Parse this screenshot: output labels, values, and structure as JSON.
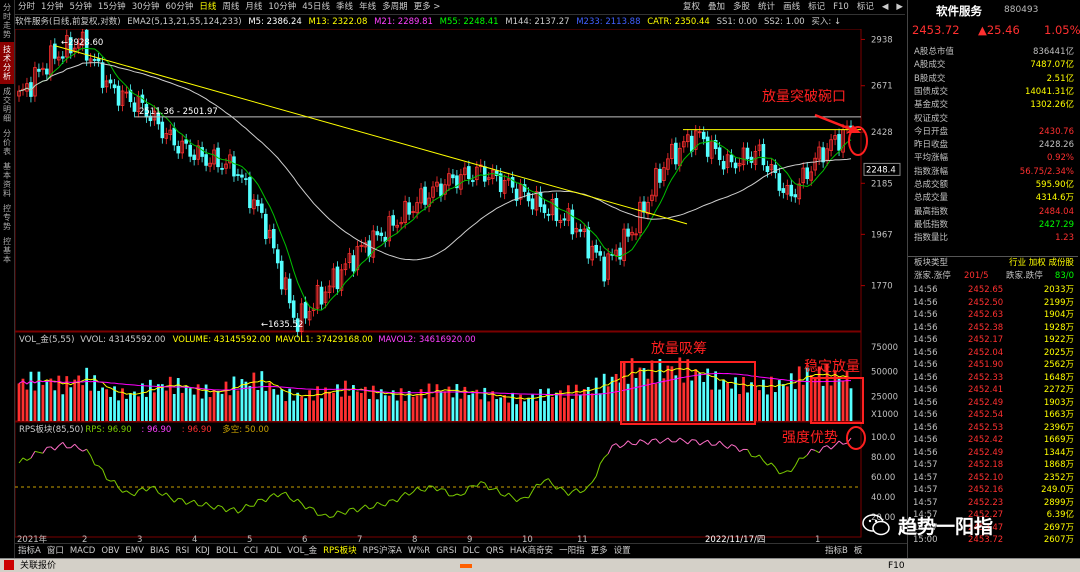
{
  "side_tabs": [
    "分时走势",
    "技术分析",
    "成交明细",
    "分价表",
    "基本资料",
    "控专势",
    "控基本"
  ],
  "active_side_tab": 1,
  "periods": [
    "分时",
    "1分钟",
    "5分钟",
    "15分钟",
    "30分钟",
    "60分钟",
    "日线",
    "周线",
    "月线",
    "10分钟",
    "45日线",
    "季线",
    "年线",
    "多周期",
    "更多 >"
  ],
  "active_period": "日线",
  "toolbar": [
    "复权",
    "叠加",
    "多股",
    "统计",
    "画线",
    "标记",
    "F10",
    "标记",
    "◀",
    "▶"
  ],
  "info": {
    "name": "软件服务(日线,前复权,对数)",
    "ema": "EMA2(5,13,21,55,124,233)",
    "m5": "M5: 2386.24",
    "m13": "M13: 2322.08",
    "m21": "M21: 2289.81",
    "m55": "M55: 2248.41",
    "m144": "M144: 2137.27",
    "m233": "M233: 2113.88",
    "catr": "CATR: 2350.44",
    "ss1": "SS1: 0.00",
    "ss2": "SS2: 1.00",
    "buy": "买入: ↓"
  },
  "price_axis": [
    "2938",
    "2671",
    "2428",
    "2185",
    "1967",
    "1770"
  ],
  "price_tag": "2248.4",
  "price_labels": {
    "high": "2928.60",
    "low": "1635.52",
    "line": "2511.36 - 2501.97"
  },
  "vol_info": {
    "name": "VOL_金(5,55)",
    "vvol": "VVOL: 43145592.00",
    "volume": "VOLUME: 43145592.00",
    "mavol1": "MAVOL1: 37429168.00",
    "mavol2": "MAVOL2: 34616920.00"
  },
  "vol_axis": [
    "75000",
    "50000",
    "25000",
    "X1000"
  ],
  "rps_info": {
    "name": "RPS板块(85,50)",
    "rps": "RPS: 96.90",
    "v2": ": 96.90",
    "v3": ": 96.90",
    "line": "多空: 50.00"
  },
  "rps_axis": [
    "100.0",
    "80.00",
    "60.00",
    "40.00",
    "20.00"
  ],
  "date_axis": [
    "2021年",
    "2",
    "3",
    "4",
    "5",
    "6",
    "7",
    "8",
    "9",
    "10",
    "11",
    "2022/11/17/四",
    "1"
  ],
  "annotations": {
    "breakout": "放量突破碗口",
    "absorb": "放量吸筹",
    "steady": "稳定放量",
    "strength": "强度优势"
  },
  "bottom_indicators": [
    "指标A",
    "窗口",
    "MACD",
    "OBV",
    "EMV",
    "BIAS",
    "RSI",
    "KDJ",
    "BOLL",
    "CCI",
    "ADL",
    "VOL_金",
    "RPS板块",
    "RPS沪深A",
    "W%R",
    "GRSI",
    "DLC",
    "QRS",
    "HAK商奇安",
    "一阳指",
    "更多",
    "设置"
  ],
  "bottom_right": [
    "指标B",
    "板"
  ],
  "active_indicator": "RPS板块",
  "stock": {
    "title": "软件服务",
    "code": "880493",
    "price": "2453.72",
    "change": "▲25.46",
    "pct": "1.05%"
  },
  "stats": [
    {
      "label": "A股总市值",
      "value": "836441亿",
      "color": "#c0c0c0"
    },
    {
      "label": "A股成交",
      "value": "7487.07亿",
      "color": "#ffff00"
    },
    {
      "label": "B股成交",
      "value": "2.51亿",
      "color": "#ffff00"
    },
    {
      "label": "国债成交",
      "value": "14041.31亿",
      "color": "#ffff00"
    },
    {
      "label": "基金成交",
      "value": "1302.26亿",
      "color": "#ffff00"
    },
    {
      "label": "权证成交",
      "value": "",
      "color": "#ffff00"
    },
    {
      "label": "今日开盘",
      "value": "2430.76",
      "color": "#ff3030"
    },
    {
      "label": "昨日收盘",
      "value": "2428.26",
      "color": "#c0c0c0"
    },
    {
      "label": "平均涨幅",
      "value": "0.92%",
      "color": "#ff3030"
    },
    {
      "label": "指数涨幅",
      "value": "56.75/2.34%",
      "color": "#ff3030"
    },
    {
      "label": "总成交额",
      "value": "595.90亿",
      "color": "#ffff00"
    },
    {
      "label": "总成交量",
      "value": "4314.6万",
      "color": "#ffff00"
    },
    {
      "label": "最高指数",
      "value": "2484.04",
      "color": "#ff3030"
    },
    {
      "label": "最低指数",
      "value": "2427.29",
      "color": "#00ff00"
    },
    {
      "label": "指数量比",
      "value": "1.23",
      "color": "#ff3030"
    }
  ],
  "sector": {
    "label": "板块类型",
    "value": "行业 加权 成份股"
  },
  "updown": {
    "up_label": "涨家.涨停",
    "up_val": "201/5",
    "down_label": "跌家.跌停",
    "down_val": "83/0"
  },
  "ticks": [
    {
      "t": "14:56",
      "p": "2452.65",
      "q": "2033万"
    },
    {
      "t": "14:56",
      "p": "2452.50",
      "q": "2199万"
    },
    {
      "t": "14:56",
      "p": "2452.63",
      "q": "1904万"
    },
    {
      "t": "14:56",
      "p": "2452.38",
      "q": "1928万"
    },
    {
      "t": "14:56",
      "p": "2452.17",
      "q": "1922万"
    },
    {
      "t": "14:56",
      "p": "2452.04",
      "q": "2025万"
    },
    {
      "t": "14:56",
      "p": "2451.90",
      "q": "2562万"
    },
    {
      "t": "14:56",
      "p": "2452.33",
      "q": "1648万"
    },
    {
      "t": "14:56",
      "p": "2452.41",
      "q": "2272万"
    },
    {
      "t": "14:56",
      "p": "2452.49",
      "q": "1903万"
    },
    {
      "t": "14:56",
      "p": "2452.54",
      "q": "1663万"
    },
    {
      "t": "14:56",
      "p": "2452.53",
      "q": "2396万"
    },
    {
      "t": "14:56",
      "p": "2452.42",
      "q": "1669万"
    },
    {
      "t": "14:56",
      "p": "2452.49",
      "q": "1344万"
    },
    {
      "t": "14:57",
      "p": "2452.18",
      "q": "1868万"
    },
    {
      "t": "14:57",
      "p": "2452.10",
      "q": "2352万"
    },
    {
      "t": "14:57",
      "p": "2452.16",
      "q": "249.0万"
    },
    {
      "t": "14:57",
      "p": "2452.23",
      "q": "2899万"
    },
    {
      "t": "14:57",
      "p": "2452.27",
      "q": "6.39亿"
    },
    {
      "t": "14:57",
      "p": "2453.47",
      "q": "2697万"
    },
    {
      "t": "15:00",
      "p": "2453.72",
      "q": "2607万"
    }
  ],
  "watermark": "趋势一阳指",
  "status": "关联报价",
  "status_right": "F10",
  "colors": {
    "up": "#ff3030",
    "down": "#54ffff",
    "ma_yellow": "#ffff00",
    "ma_green": "#00c000",
    "ma_white": "#cfcfcf",
    "vol_ma1": "#ffff00",
    "vol_ma2": "#ff00ff",
    "rps_high": "#ff6ec7",
    "rps_low": "#7ccc00",
    "annotation": "#ff2020"
  },
  "chart_data": [
    {
      "type": "candlestick",
      "title": "软件服务(日线,前复权,对数)",
      "y_scale": "log",
      "ylim": [
        1635.52,
        2928.6
      ],
      "points": [
        [
          "2021-01",
          2610
        ],
        [
          "2021-01-mid",
          2820
        ],
        [
          "2021-02",
          2928.6
        ],
        [
          "2021-02-end",
          2650
        ],
        [
          "2021-03",
          2560
        ],
        [
          "2021-03-mid",
          2380
        ],
        [
          "2021-04",
          2300
        ],
        [
          "2021-04-mid",
          2260
        ],
        [
          "2021-04-end",
          2010
        ],
        [
          "2021-05",
          1635.52
        ],
        [
          "2021-05-mid",
          1760
        ],
        [
          "2021-06",
          1900
        ],
        [
          "2021-06-mid",
          1990
        ],
        [
          "2021-07",
          2110
        ],
        [
          "2021-07-mid",
          2200
        ],
        [
          "2021-08",
          2240
        ],
        [
          "2021-08-mid",
          2170
        ],
        [
          "2021-09",
          2080
        ],
        [
          "2021-09-mid",
          2010
        ],
        [
          "2021-10",
          1840
        ],
        [
          "2021-10-mid",
          2000
        ],
        [
          "2021-11",
          2290
        ],
        [
          "2021-11-mid",
          2420
        ],
        [
          "2021-12",
          2270
        ],
        [
          "2021-12-mid",
          2330
        ],
        [
          "2022-01",
          2120
        ],
        [
          "2022-01-mid",
          2320
        ],
        [
          "2022-01-end",
          2453.72
        ]
      ],
      "trend_lines": [
        {
          "label": "2511.36 - 2501.97",
          "value": 2505
        }
      ],
      "breakout_line": 2440
    },
    {
      "type": "bar",
      "title": "VOL_金(5,55)",
      "unit": "X1000",
      "ylim": [
        0,
        75000
      ],
      "values": [
        38000,
        42000,
        36000,
        45000,
        30000,
        26000,
        34000,
        37000,
        31000,
        29000,
        38000,
        42000,
        27000,
        25000,
        30000,
        33000,
        29000,
        27000,
        26000,
        32000,
        30000,
        28000,
        24000,
        22000,
        27000,
        29000,
        32000,
        42000,
        52000,
        50000,
        54000,
        48000,
        39000,
        36000,
        35000,
        38000,
        48000,
        46000,
        43145.592
      ]
    },
    {
      "type": "line",
      "title": "RPS板块(85,50)",
      "ylim": [
        0,
        100
      ],
      "values": [
        74,
        86,
        92,
        88,
        60,
        42,
        50,
        38,
        34,
        30,
        26,
        36,
        44,
        32,
        20,
        26,
        30,
        35,
        46,
        50,
        40,
        55,
        44,
        36,
        58,
        44,
        48,
        90,
        94,
        96,
        97,
        95,
        93,
        88,
        77,
        62,
        84,
        90,
        96.9
      ],
      "reference": 50
    }
  ]
}
